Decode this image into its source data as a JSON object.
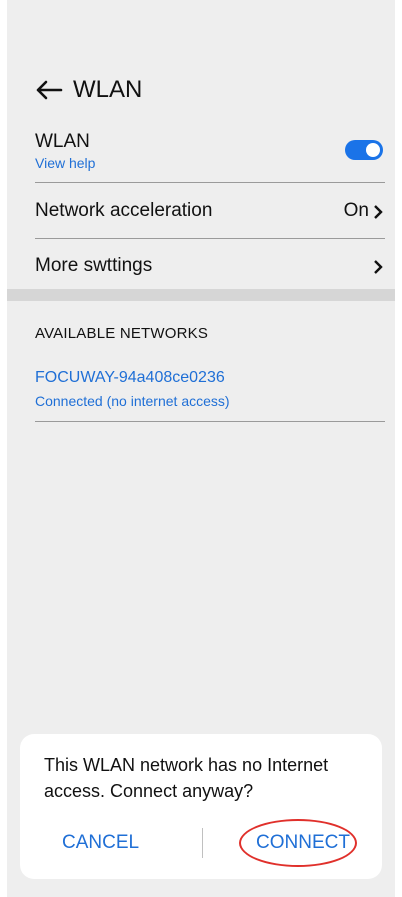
{
  "header": {
    "title": "WLAN",
    "back_icon": "arrow-left-icon"
  },
  "wlan_row": {
    "label": "WLAN",
    "help_link": "View help",
    "toggle_on": true,
    "accent": "#1a73e8"
  },
  "network_acceleration": {
    "label": "Network acceleration",
    "value": "On",
    "icon": "chevron-right-icon"
  },
  "more_settings": {
    "label": "More swttings",
    "icon": "chevron-right-icon"
  },
  "available": {
    "heading": "AVAILABLE NETWORKS",
    "networks": [
      {
        "name": "FOCUWAY-94a408ce0236",
        "status": "Connected (no internet access)"
      }
    ]
  },
  "dialog": {
    "message": "This WLAN network has no Internet access. Connect anyway?",
    "cancel_label": "CANCEL",
    "connect_label": "CONNECT",
    "highlight_color": "#e0302b"
  }
}
